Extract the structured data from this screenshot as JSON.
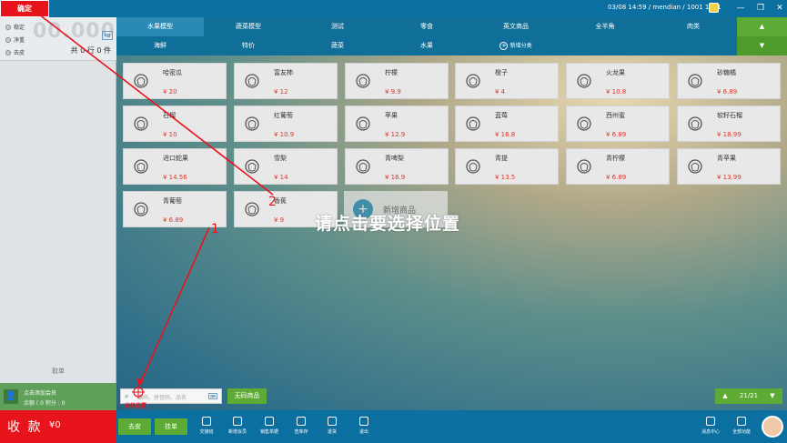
{
  "topbar": {
    "confirm_label": "确定",
    "status": "03/08 14:59 / mendian / 1001 1001",
    "minimize": "—",
    "maximize": "❐",
    "close": "✕"
  },
  "scale": {
    "options": [
      "稳定",
      "净重",
      "去皮"
    ],
    "weight": "00.000",
    "unit": "kg",
    "summary": "共 0 行 0 件"
  },
  "left": {
    "take_order": "取单",
    "member_add": "点击添加会员",
    "member_info": "余额 ( 0  积分 : 0"
  },
  "categories": {
    "row1": [
      "水果模型",
      "蔬菜模型",
      "测试",
      "零食",
      "英文商品",
      "全半角",
      "肉类"
    ],
    "row2": [
      "海鲜",
      "特价",
      "蔬菜",
      "水果",
      "新增分类"
    ],
    "up": "▲",
    "down": "▼"
  },
  "products": [
    {
      "name": "哈密瓜",
      "price": "¥ 20"
    },
    {
      "name": "富友柿",
      "price": "¥ 12"
    },
    {
      "name": "柠檬",
      "price": "¥ 9.9"
    },
    {
      "name": "橙子",
      "price": "¥ 4"
    },
    {
      "name": "火龙果",
      "price": "¥ 10.8"
    },
    {
      "name": "砂糖橘",
      "price": "¥ 6.89"
    },
    {
      "name": "石榴",
      "price": "¥ 10"
    },
    {
      "name": "红葡萄",
      "price": "¥ 10.9"
    },
    {
      "name": "苹果",
      "price": "¥ 12.9"
    },
    {
      "name": "蓝莓",
      "price": "¥ 16.8"
    },
    {
      "name": "西州蜜",
      "price": "¥ 6.89"
    },
    {
      "name": "软籽石榴",
      "price": "¥ 18.99"
    },
    {
      "name": "进口蛇果",
      "price": "¥ 14.56"
    },
    {
      "name": "雪梨",
      "price": "¥ 14"
    },
    {
      "name": "青啤梨",
      "price": "¥ 16.9"
    },
    {
      "name": "青提",
      "price": "¥ 13.5"
    },
    {
      "name": "青柠檬",
      "price": "¥ 6.89"
    },
    {
      "name": "青苹果",
      "price": "¥ 13.99"
    },
    {
      "name": "青葡萄",
      "price": "¥ 6.89"
    },
    {
      "name": "香蕉",
      "price": "¥ 9"
    }
  ],
  "add_product": "新增商品",
  "overlay_text": "请点击要选择位置",
  "search": {
    "placeholder": "编码、拼音码、品名",
    "barcode_free": "无码商品",
    "kbd": "⌨"
  },
  "pagination": {
    "prev": "▲",
    "indicator": "21/21",
    "next": "▼"
  },
  "bottom": {
    "checkout_label": "收 款",
    "checkout_amount": "¥0",
    "peel": "去皮",
    "hold": "挂单",
    "tools": [
      "交接班",
      "新增会员",
      "销售单据",
      "查库存",
      "退货",
      "退出"
    ],
    "message_center": "消息中心",
    "all_functions": "全部功能"
  },
  "annotations": {
    "num1": "1",
    "num2": "2",
    "current_pos": "当前位置"
  },
  "colors": {
    "accent": "#0b6fa0",
    "green": "#5daa34",
    "red": "#e8141b",
    "price": "#e0352b"
  }
}
